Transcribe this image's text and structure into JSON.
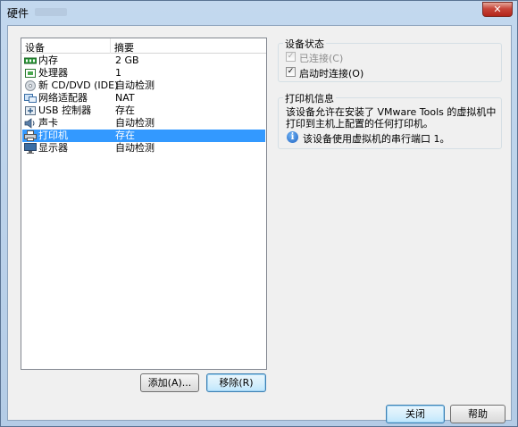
{
  "window": {
    "title": "硬件",
    "close_glyph": "✕"
  },
  "device_list": {
    "headers": {
      "device": "设备",
      "summary": "摘要"
    },
    "rows": [
      {
        "name": "内存",
        "summary": "2 GB",
        "icon": "memory-icon"
      },
      {
        "name": "处理器",
        "summary": "1",
        "icon": "processor-icon"
      },
      {
        "name": "新 CD/DVD (IDE)",
        "summary": "自动检测",
        "icon": "cd-dvd-icon"
      },
      {
        "name": "网络适配器",
        "summary": "NAT",
        "icon": "network-adapter-icon"
      },
      {
        "name": "USB 控制器",
        "summary": "存在",
        "icon": "usb-controller-icon"
      },
      {
        "name": "声卡",
        "summary": "自动检测",
        "icon": "sound-card-icon"
      },
      {
        "name": "打印机",
        "summary": "存在",
        "icon": "printer-icon",
        "selected": true
      },
      {
        "name": "显示器",
        "summary": "自动检测",
        "icon": "display-icon"
      }
    ]
  },
  "buttons": {
    "add": "添加(A)...",
    "remove": "移除(R)",
    "close": "关闭",
    "help": "帮助"
  },
  "device_status": {
    "title": "设备状态",
    "connected_label": "已连接(C)",
    "connect_at_power_on_label": "启动时连接(O)",
    "check_glyph": "✓"
  },
  "printer_info": {
    "title": "打印机信息",
    "description": "该设备允许在安装了 VMware Tools 的虚拟机中打印到主机上配置的任何打印机。",
    "note": "该设备使用虚拟机的串行端口 1。",
    "info_glyph": "i"
  },
  "colors": {
    "selection": "#3399ff",
    "window_frame": "#b9d1ea"
  }
}
